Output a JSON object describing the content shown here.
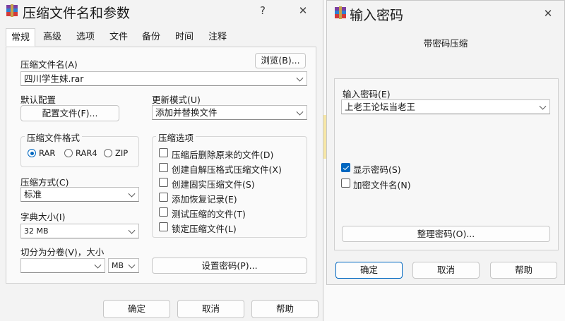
{
  "dialog_main": {
    "title": "压缩文件名和参数",
    "help_icon": "?",
    "close_icon": "✕",
    "tabs": [
      "常规",
      "高级",
      "选项",
      "文件",
      "备份",
      "时间",
      "注释"
    ],
    "archive_name_label": "压缩文件名(A)",
    "archive_name_value": "四川学生妹.rar",
    "browse_button": "浏览(B)...",
    "default_config_label": "默认配置",
    "config_file_button": "配置文件(F)...",
    "update_mode_label": "更新模式(U)",
    "update_mode_value": "添加并替换文件",
    "format_group_label": "压缩文件格式",
    "format_options": [
      "RAR",
      "RAR4",
      "ZIP"
    ],
    "selected_format": "RAR",
    "method_label": "压缩方式(C)",
    "method_value": "标准",
    "dict_label": "字典大小(I)",
    "dict_value": "32 MB",
    "split_label": "切分为分卷(V)，大小",
    "split_value": "",
    "split_unit": "MB",
    "options_group_label": "压缩选项",
    "options": [
      {
        "label": "压缩后删除原来的文件(D)",
        "checked": false
      },
      {
        "label": "创建自解压格式压缩文件(X)",
        "checked": false
      },
      {
        "label": "创建固实压缩文件(S)",
        "checked": false
      },
      {
        "label": "添加恢复记录(E)",
        "checked": false
      },
      {
        "label": "测试压缩的文件(T)",
        "checked": false
      },
      {
        "label": "锁定压缩文件(L)",
        "checked": false
      }
    ],
    "set_password_button": "设置密码(P)...",
    "ok_button": "确定",
    "cancel_button": "取消",
    "help_button": "帮助"
  },
  "dialog_password": {
    "title": "输入密码",
    "close_icon": "✕",
    "subtitle": "带密码压缩",
    "password_label": "输入密码(E)",
    "password_value": "上老王论坛当老王",
    "show_password_label": "显示密码(S)",
    "show_password_checked": true,
    "encrypt_names_label": "加密文件名(N)",
    "encrypt_names_checked": false,
    "organize_button": "整理密码(O)...",
    "ok_button": "确定",
    "cancel_button": "取消",
    "help_button": "帮助"
  },
  "colors": {
    "accent": "#0067c0",
    "dialog_bg": "#f3f3f3",
    "background_yellow": "#f7e7a6"
  }
}
